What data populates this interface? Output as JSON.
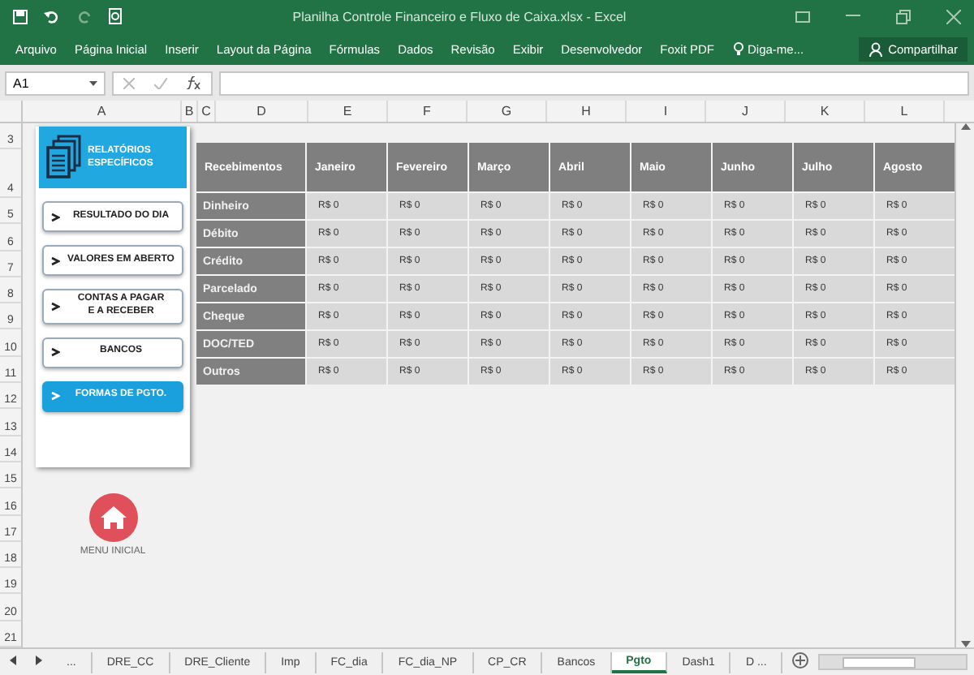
{
  "window": {
    "title": "Planilha Controle Financeiro e Fluxo de Caixa.xlsx - Excel"
  },
  "menu": [
    {
      "label": "Arquivo"
    },
    {
      "label": "Página Inicial"
    },
    {
      "label": "Inserir"
    },
    {
      "label": "Layout da Página"
    },
    {
      "label": "Fórmulas"
    },
    {
      "label": "Dados"
    },
    {
      "label": "Revisão"
    },
    {
      "label": "Exibir"
    },
    {
      "label": "Desenvolvedor"
    },
    {
      "label": "Foxit PDF"
    }
  ],
  "tell_me": "Diga-me...",
  "share": "Compartilhar",
  "formula_bar": {
    "name_box": "A1"
  },
  "columns": [
    "A",
    "B",
    "C",
    "D",
    "E",
    "F",
    "G",
    "H",
    "I",
    "J",
    "K",
    "L"
  ],
  "rows": [
    "3",
    "4",
    "5",
    "6",
    "7",
    "8",
    "9",
    "10",
    "11",
    "12",
    "13",
    "14",
    "15",
    "16",
    "17",
    "18",
    "19",
    "20",
    "21"
  ],
  "nav": {
    "header": "RELATÓRIOS ESPECÍFICOS",
    "buttons": [
      {
        "label": "RESULTADO DO DIA",
        "selected": false
      },
      {
        "label": "VALORES EM ABERTO",
        "selected": false
      },
      {
        "label": "CONTAS A PAGAR\nE A RECEBER",
        "selected": false
      },
      {
        "label": "BANCOS",
        "selected": false
      },
      {
        "label": "FORMAS DE PGTO.",
        "selected": true
      }
    ]
  },
  "home": {
    "label": "MENU INICIAL"
  },
  "table": {
    "columns": [
      "Recebimentos",
      "Janeiro",
      "Fevereiro",
      "Março",
      "Abril",
      "Maio",
      "Junho",
      "Julho",
      "Agosto"
    ],
    "rows": [
      {
        "cells": [
          "Dinheiro",
          "R$ 0",
          "R$ 0",
          "R$ 0",
          "R$ 0",
          "R$ 0",
          "R$ 0",
          "R$ 0",
          "R$ 0"
        ]
      },
      {
        "cells": [
          "Débito",
          "R$ 0",
          "R$ 0",
          "R$ 0",
          "R$ 0",
          "R$ 0",
          "R$ 0",
          "R$ 0",
          "R$ 0"
        ]
      },
      {
        "cells": [
          "Crédito",
          "R$ 0",
          "R$ 0",
          "R$ 0",
          "R$ 0",
          "R$ 0",
          "R$ 0",
          "R$ 0",
          "R$ 0"
        ]
      },
      {
        "cells": [
          "Parcelado",
          "R$ 0",
          "R$ 0",
          "R$ 0",
          "R$ 0",
          "R$ 0",
          "R$ 0",
          "R$ 0",
          "R$ 0"
        ]
      },
      {
        "cells": [
          "Cheque",
          "R$ 0",
          "R$ 0",
          "R$ 0",
          "R$ 0",
          "R$ 0",
          "R$ 0",
          "R$ 0",
          "R$ 0"
        ]
      },
      {
        "cells": [
          "DOC/TED",
          "R$ 0",
          "R$ 0",
          "R$ 0",
          "R$ 0",
          "R$ 0",
          "R$ 0",
          "R$ 0",
          "R$ 0"
        ]
      },
      {
        "cells": [
          "Outros",
          "R$ 0",
          "R$ 0",
          "R$ 0",
          "R$ 0",
          "R$ 0",
          "R$ 0",
          "R$ 0",
          "R$ 0"
        ]
      }
    ]
  },
  "sheet_overflow": "...",
  "sheet_tabs": [
    {
      "label": "DRE_CC",
      "selected": false
    },
    {
      "label": "DRE_Cliente",
      "selected": false
    },
    {
      "label": "Imp",
      "selected": false
    },
    {
      "label": "FC_dia",
      "selected": false
    },
    {
      "label": "FC_dia_NP",
      "selected": false
    },
    {
      "label": "CP_CR",
      "selected": false
    },
    {
      "label": "Bancos",
      "selected": false
    },
    {
      "label": "Pgto",
      "selected": true
    },
    {
      "label": "Dash1",
      "selected": false
    },
    {
      "label": "D ...",
      "selected": false
    }
  ]
}
